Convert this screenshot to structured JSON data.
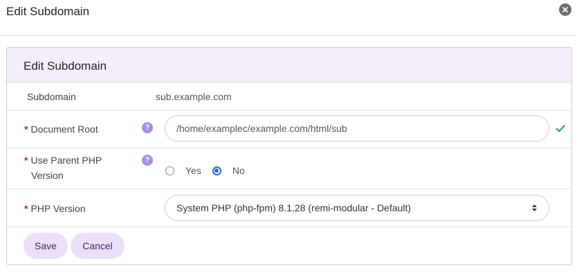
{
  "dialog": {
    "title": "Edit Subdomain",
    "close_icon": "close-icon"
  },
  "panel": {
    "title": "Edit Subdomain"
  },
  "form": {
    "subdomain": {
      "label": "Subdomain",
      "value": "sub.example.com"
    },
    "document_root": {
      "required_mark": "*",
      "label": "Document Root",
      "help": "?",
      "value": "/home/examplec/example.com/html/sub",
      "status_icon": "check-icon",
      "status_color": "#3aa34a"
    },
    "use_parent_php": {
      "required_mark": "*",
      "label_line1": "Use Parent PHP",
      "label_line2": "Version",
      "help": "?",
      "options": [
        "Yes",
        "No"
      ],
      "selected": "No"
    },
    "php_version": {
      "required_mark": "*",
      "label": "PHP Version",
      "selected": "System PHP (php-fpm) 8.1.28 (remi-modular - Default)"
    }
  },
  "actions": {
    "save_label": "Save",
    "cancel_label": "Cancel"
  },
  "colors": {
    "accent": "#2a69d6",
    "heading_bg": "#f4eefa",
    "button_bg": "#ecdffa",
    "help_bg": "#a88ee5"
  }
}
